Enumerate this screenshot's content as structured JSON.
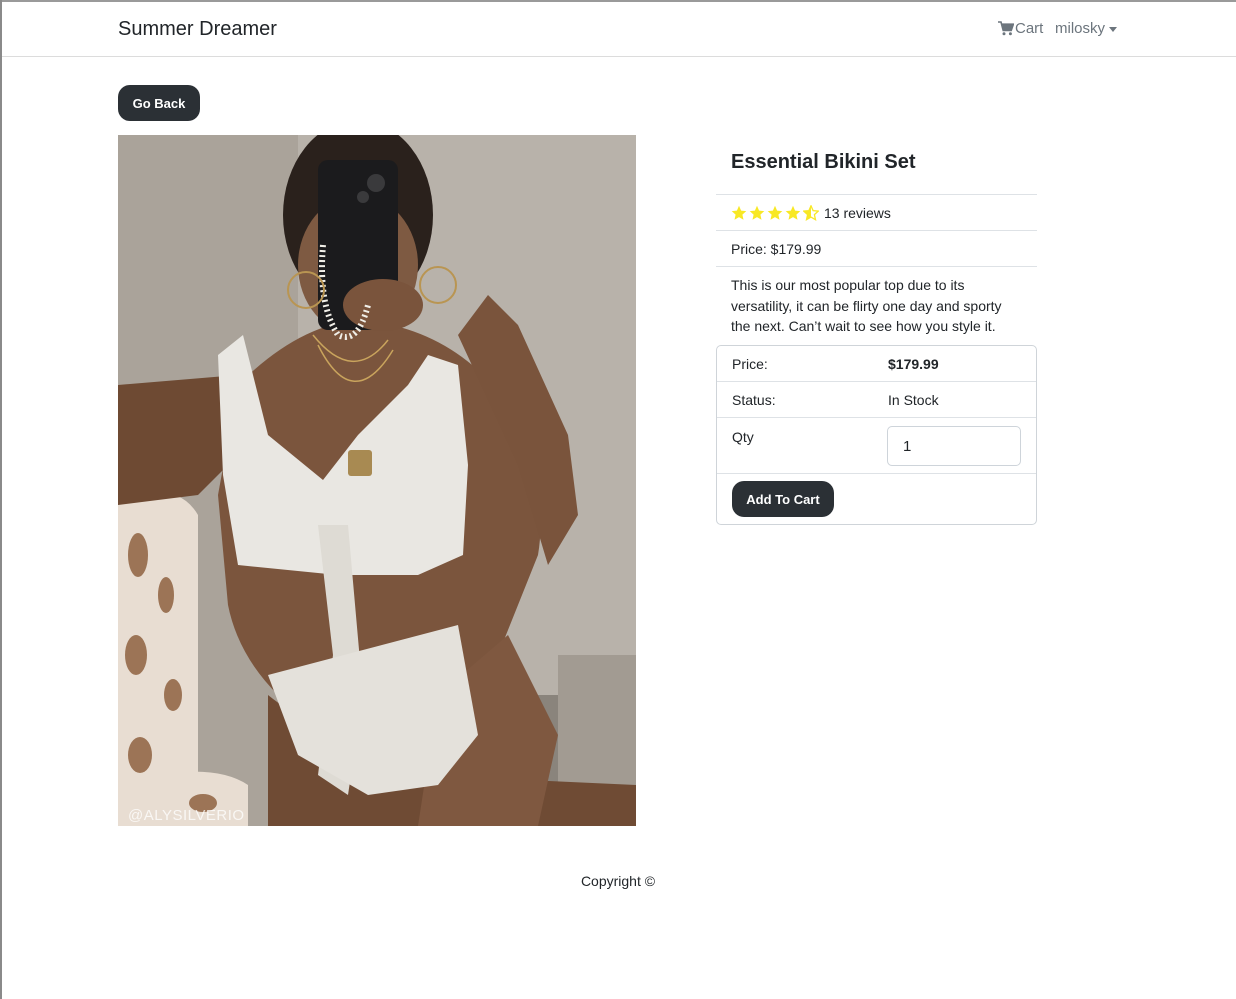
{
  "navbar": {
    "brand": "Summer Dreamer",
    "cart_label": "Cart",
    "cart_icon": "cart-icon",
    "user_label": "milosky",
    "user_icon": "caret-down-icon"
  },
  "go_back_label": "Go Back",
  "product": {
    "name": "Essential Bikini Set",
    "rating": 4.5,
    "rating_max": 5,
    "reviews_text": "13 reviews",
    "price_line": "Price: $179.99",
    "description": "This is our most popular top due to its versatility, it can be flirty one day and sporty the next. Can’t wait to see how you style it.",
    "image_watermark": "@ALYSILVERIO",
    "star_color": "#f8e825"
  },
  "purchase": {
    "price_label": "Price:",
    "price_value": "$179.99",
    "status_label": "Status:",
    "status_value": "In Stock",
    "qty_label": "Qty",
    "qty_value": "1",
    "add_to_cart_label": "Add To Cart"
  },
  "footer": {
    "copyright": "Copyright ©"
  },
  "colors": {
    "button_dark": "#2b3035",
    "text": "#212529",
    "nav_muted": "#6c757d"
  }
}
